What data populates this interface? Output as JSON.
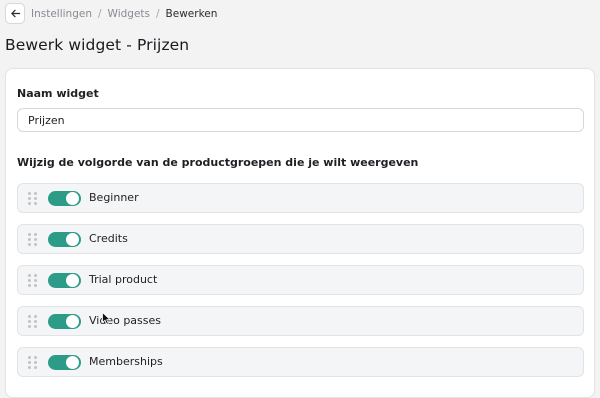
{
  "breadcrumb": {
    "items": [
      "Instellingen",
      "Widgets"
    ],
    "current": "Bewerken",
    "separator": "/"
  },
  "back_icon": "arrow-left-icon",
  "page": {
    "title": "Bewerk widget - Prijzen"
  },
  "form": {
    "name_label": "Naam widget",
    "name_value": "Prijzen",
    "order_label": "Wijzig de volgorde van de productgroepen die je wilt weergeven"
  },
  "product_groups": [
    {
      "label": "Beginner",
      "enabled": true
    },
    {
      "label": "Credits",
      "enabled": true
    },
    {
      "label": "Trial product",
      "enabled": true
    },
    {
      "label": "Video passes",
      "enabled": true
    },
    {
      "label": "Memberships",
      "enabled": true
    }
  ],
  "colors": {
    "toggle_on": "#2c9b88",
    "row_background": "#f4f5f6",
    "page_background": "#f3f3f4"
  }
}
